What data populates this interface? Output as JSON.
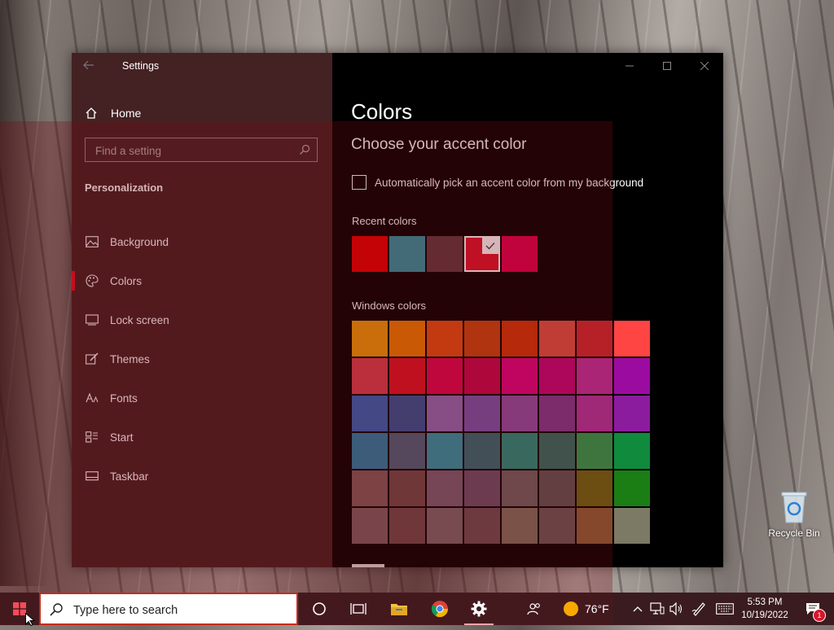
{
  "window": {
    "title": "Settings",
    "back_icon": "back-arrow-icon",
    "controls": [
      "minimize-icon",
      "maximize-icon",
      "close-icon"
    ]
  },
  "sidebar": {
    "home_label": "Home",
    "search_placeholder": "Find a setting",
    "section": "Personalization",
    "items": [
      {
        "label": "Background",
        "icon": "image-icon"
      },
      {
        "label": "Colors",
        "icon": "palette-icon",
        "active": true
      },
      {
        "label": "Lock screen",
        "icon": "lock-screen-icon"
      },
      {
        "label": "Themes",
        "icon": "brush-icon"
      },
      {
        "label": "Fonts",
        "icon": "font-icon"
      },
      {
        "label": "Start",
        "icon": "start-layout-icon"
      },
      {
        "label": "Taskbar",
        "icon": "taskbar-icon"
      }
    ]
  },
  "content": {
    "title": "Colors",
    "subtitle": "Choose your accent color",
    "auto_pick_label": "Automatically pick an accent color from my background",
    "auto_pick_checked": false,
    "recent_label": "Recent colors",
    "recent_colors": [
      "#e60000",
      "#2b95a3",
      "#5e3a3f",
      "#e0142a",
      "#e1004f"
    ],
    "recent_selected": "#e0142a",
    "windows_label": "Windows colors",
    "windows_colors": [
      [
        "#ed9a06",
        "#ee7c00",
        "#e4500f",
        "#c9470f",
        "#d13708",
        "#df5444",
        "#d12b31",
        "#ff4444"
      ],
      [
        "#d7404d",
        "#df1426",
        "#e0064f",
        "#c6064c",
        "#de0480",
        "#c3067a",
        "#c1329f",
        "#9c0ba0"
      ],
      [
        "#2f63b7",
        "#2d5596",
        "#8e6cb7",
        "#7755ae",
        "#8f50a5",
        "#7e3b90",
        "#b035a3",
        "#8b1c9e"
      ],
      [
        "#2380a6",
        "#47627c",
        "#2799aa",
        "#2c6e75",
        "#1f937e",
        "#2a7265",
        "#26a451",
        "#108a3d"
      ],
      [
        "#7f5b59",
        "#6e4b4a",
        "#766174",
        "#68516b",
        "#6b6463",
        "#5c5755",
        "#686b12",
        "#1a7e15"
      ],
      [
        "#7b5f62",
        "#6e4b4d",
        "#776869",
        "#694f54",
        "#7b715e",
        "#665a58",
        "#8c6338",
        "#7c7965"
      ]
    ]
  },
  "desktop": {
    "recycle_bin_label": "Recycle Bin"
  },
  "taskbar": {
    "search_placeholder": "Type here to search",
    "weather_temp": "76°F",
    "time": "5:53 PM",
    "date": "10/19/2022",
    "notification_count": "1",
    "accent": "#e81123"
  }
}
